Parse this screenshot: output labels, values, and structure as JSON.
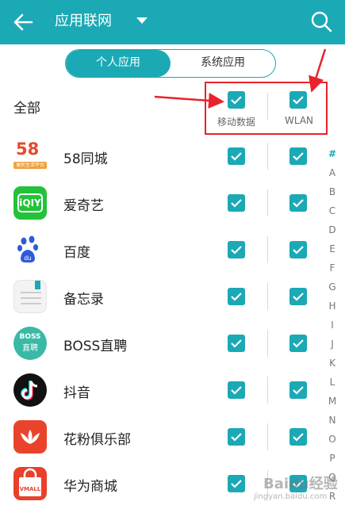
{
  "header": {
    "title": "应用联网"
  },
  "tabs": [
    {
      "label": "个人应用",
      "active": true
    },
    {
      "label": "系统应用",
      "active": false
    }
  ],
  "all_row": {
    "label": "全部",
    "mobile_label": "移动数据",
    "wlan_label": "WLAN"
  },
  "apps": [
    {
      "name": "58同城",
      "mobile": true,
      "wlan": true
    },
    {
      "name": "爱奇艺",
      "mobile": true,
      "wlan": true
    },
    {
      "name": "百度",
      "mobile": true,
      "wlan": true
    },
    {
      "name": "备忘录",
      "mobile": true,
      "wlan": true
    },
    {
      "name": "BOSS直聘",
      "mobile": true,
      "wlan": true
    },
    {
      "name": "抖音",
      "mobile": true,
      "wlan": true
    },
    {
      "name": "花粉俱乐部",
      "mobile": true,
      "wlan": true
    },
    {
      "name": "华为商城",
      "mobile": true,
      "wlan": true
    }
  ],
  "icons": {
    "58": {
      "text": "58",
      "sub": "便民生活平台"
    },
    "iqiyi": {
      "text": "iQIY"
    },
    "boss": {
      "line1": "BOSS",
      "line2": "直聘"
    },
    "vmall": {
      "text": "VMALL"
    }
  },
  "alphabet": [
    "#",
    "A",
    "B",
    "C",
    "D",
    "E",
    "F",
    "G",
    "H",
    "I",
    "J",
    "K",
    "L",
    "M",
    "N",
    "O",
    "P",
    "Q",
    "R"
  ],
  "watermark": {
    "text": "Baidu经验",
    "sub": "jingyan.baidu.com"
  },
  "colors": {
    "accent": "#1ba9b5",
    "annotation": "#e8232b"
  }
}
